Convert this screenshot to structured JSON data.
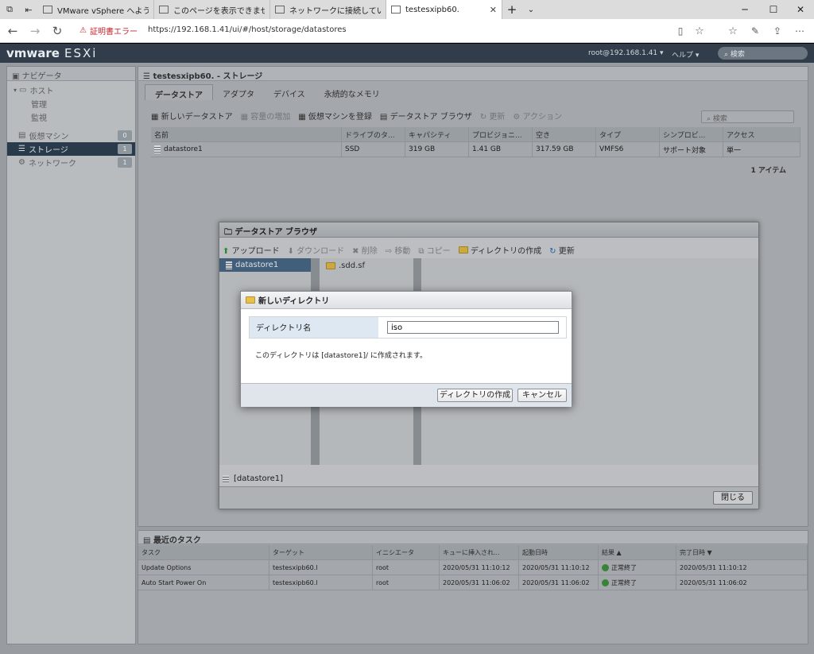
{
  "browser": {
    "tabs": [
      {
        "label": "VMware vSphere へようこそ"
      },
      {
        "label": "このページを表示できません"
      },
      {
        "label": "ネットワークに接続していません"
      },
      {
        "label": "testesxipb60."
      }
    ],
    "cert_error": "証明書エラー",
    "url": "https://192.168.1.41/ui/#/host/storage/datastores"
  },
  "esxi": {
    "logo": "vmware",
    "product": "ESXi",
    "user": "root@192.168.1.41 ▾",
    "help": "ヘルプ ▾",
    "search_placeholder": "検索"
  },
  "navigator": {
    "title": "ナビゲータ",
    "items": [
      {
        "label": "ホスト"
      },
      {
        "label": "管理"
      },
      {
        "label": "監視"
      },
      {
        "label": "仮想マシン",
        "count": "0"
      },
      {
        "label": "ストレージ",
        "count": "1"
      },
      {
        "label": "ネットワーク",
        "count": "1"
      }
    ]
  },
  "main": {
    "title": "testesxipb60. - ストレージ",
    "tabs": [
      {
        "label": "データストア"
      },
      {
        "label": "アダプタ"
      },
      {
        "label": "デバイス"
      },
      {
        "label": "永続的なメモリ"
      }
    ],
    "toolbar": [
      {
        "label": "新しいデータストア"
      },
      {
        "label": "容量の増加"
      },
      {
        "label": "仮想マシンを登録"
      },
      {
        "label": "データストア ブラウザ"
      },
      {
        "label": "更新"
      },
      {
        "label": "アクション"
      }
    ],
    "search_placeholder": "検索",
    "columns": [
      "名前",
      "ドライブのタ...",
      "キャパシティ",
      "プロビジョニ...",
      "空き",
      "タイプ",
      "シンプロビ...",
      "アクセス"
    ],
    "rows": [
      [
        "datastore1",
        "SSD",
        "319 GB",
        "1.41 GB",
        "317.59 GB",
        "VMFS6",
        "サポート対象",
        "単一"
      ]
    ],
    "footer": "1 アイテム"
  },
  "tasks": {
    "title": "最近のタスク",
    "columns": [
      "タスク",
      "ターゲット",
      "イニシエータ",
      "キューに挿入され...",
      "起動日時",
      "結果 ▲",
      "完了日時 ▼"
    ],
    "rows": [
      [
        "Update Options",
        "testesxipb60.l",
        "root",
        "2020/05/31 11:10:12",
        "2020/05/31 11:10:12",
        "正常終了",
        "2020/05/31 11:10:12"
      ],
      [
        "Auto Start Power On",
        "testesxipb60.l",
        "root",
        "2020/05/31 11:06:02",
        "2020/05/31 11:06:02",
        "正常終了",
        "2020/05/31 11:06:02"
      ]
    ]
  },
  "browser_dialog": {
    "title": "データストア ブラウザ",
    "toolbar": [
      {
        "label": "アップロード"
      },
      {
        "label": "ダウンロード"
      },
      {
        "label": "削除"
      },
      {
        "label": "移動"
      },
      {
        "label": "コピー"
      },
      {
        "label": "ディレクトリの作成"
      },
      {
        "label": "更新"
      }
    ],
    "datastore": "datastore1",
    "folder": ".sdd.sf",
    "path": "[datastore1]",
    "close": "閉じる"
  },
  "new_dir_dialog": {
    "title": "新しいディレクトリ",
    "field_label": "ディレクトリ名",
    "field_value": "iso",
    "message": "このディレクトリは [datastore1]/ に作成されます。",
    "create_button": "ディレクトリの作成",
    "cancel_button": "キャンセル"
  }
}
